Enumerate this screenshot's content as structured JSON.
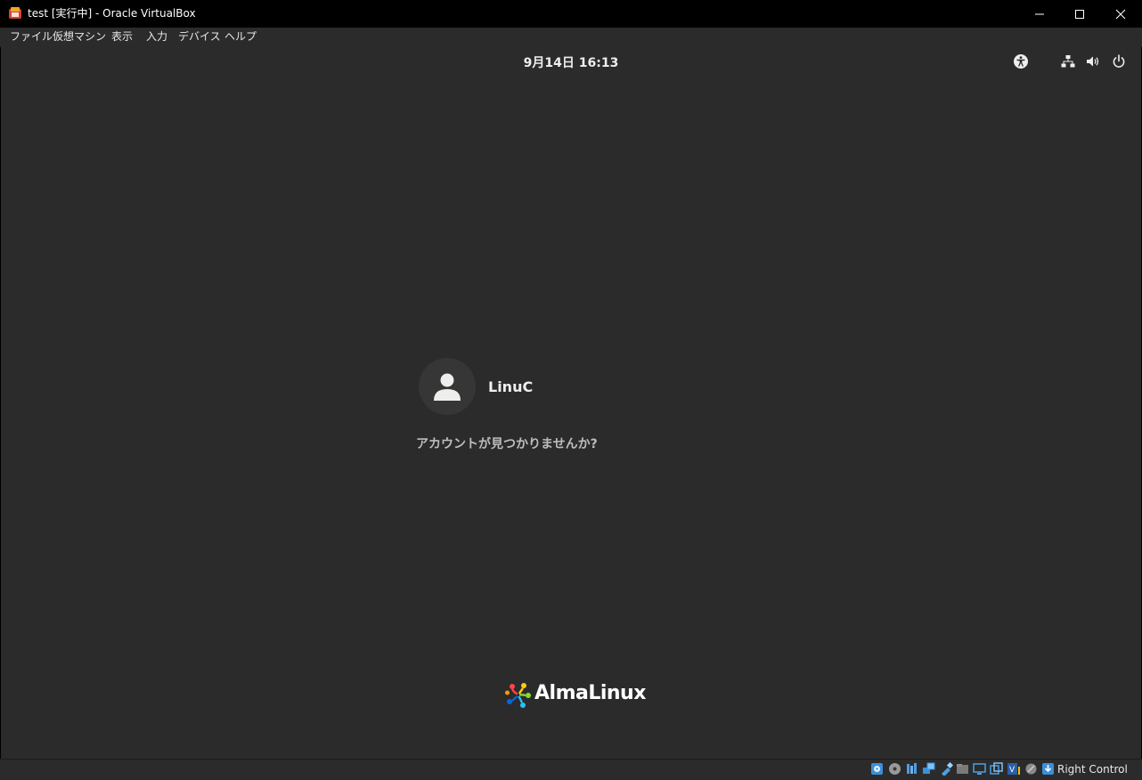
{
  "window": {
    "title": "test [実行中] - Oracle VirtualBox",
    "app_icon": "virtualbox-icon"
  },
  "menubar": {
    "items": [
      {
        "label": "ファイル"
      },
      {
        "label": "仮想マシン"
      },
      {
        "label": "表示"
      },
      {
        "label": "入力"
      },
      {
        "label": "デバイス"
      },
      {
        "label": "ヘルプ"
      }
    ]
  },
  "guest": {
    "clock": "9月14日  16:13",
    "tray_icons": [
      "accessibility-icon",
      "network-icon",
      "volume-icon",
      "power-icon"
    ],
    "user": {
      "name": "LinuC"
    },
    "not_listed": "アカウントが見つかりませんか?",
    "brand": "AlmaLinux",
    "background_color": "#2b2b2b"
  },
  "statusbar": {
    "icons": [
      "hard-disk-icon",
      "optical-drive-icon",
      "audio-icon",
      "network-icon",
      "usb-icon",
      "shared-folders-icon",
      "display-icon",
      "video-capture-icon",
      "cpu-vtx-icon",
      "mouse-integration-icon",
      "keyboard-capture-icon"
    ],
    "host_key": "Right Control"
  }
}
